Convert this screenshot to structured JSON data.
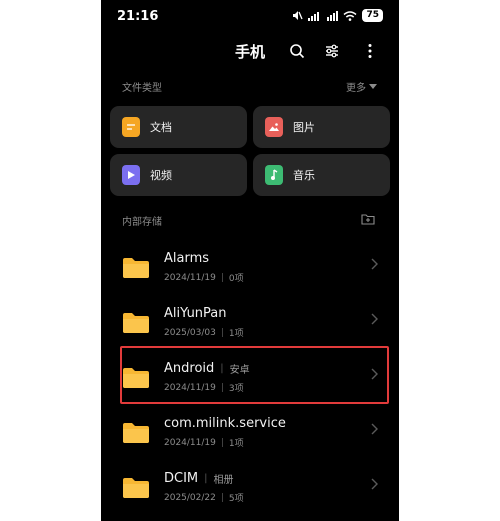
{
  "status_bar": {
    "time": "21:16",
    "battery": "75"
  },
  "header": {
    "title": "手机"
  },
  "categories_section": {
    "label": "文件类型",
    "more_label": "更多",
    "items": [
      {
        "label": "文档",
        "icon": "document-icon",
        "color": "#f5a623"
      },
      {
        "label": "图片",
        "icon": "image-icon",
        "color": "#e8605a"
      },
      {
        "label": "视频",
        "icon": "video-icon",
        "color": "#7b6ff0"
      },
      {
        "label": "音乐",
        "icon": "music-icon",
        "color": "#3dbb73"
      }
    ]
  },
  "storage_section": {
    "label": "内部存储",
    "folders": [
      {
        "name": "Alarms",
        "tag": "",
        "date": "2024/11/19",
        "count": "0项"
      },
      {
        "name": "AliYunPan",
        "tag": "",
        "date": "2025/03/03",
        "count": "1项"
      },
      {
        "name": "Android",
        "tag": "安卓",
        "date": "2024/11/19",
        "count": "3项"
      },
      {
        "name": "com.milink.service",
        "tag": "",
        "date": "2024/11/19",
        "count": "1项"
      },
      {
        "name": "DCIM",
        "tag": "相册",
        "date": "2025/02/22",
        "count": "5项"
      }
    ]
  },
  "colors": {
    "folder": "#f7b733",
    "highlight": "#e23b3b",
    "tile_bg": "#262626"
  }
}
